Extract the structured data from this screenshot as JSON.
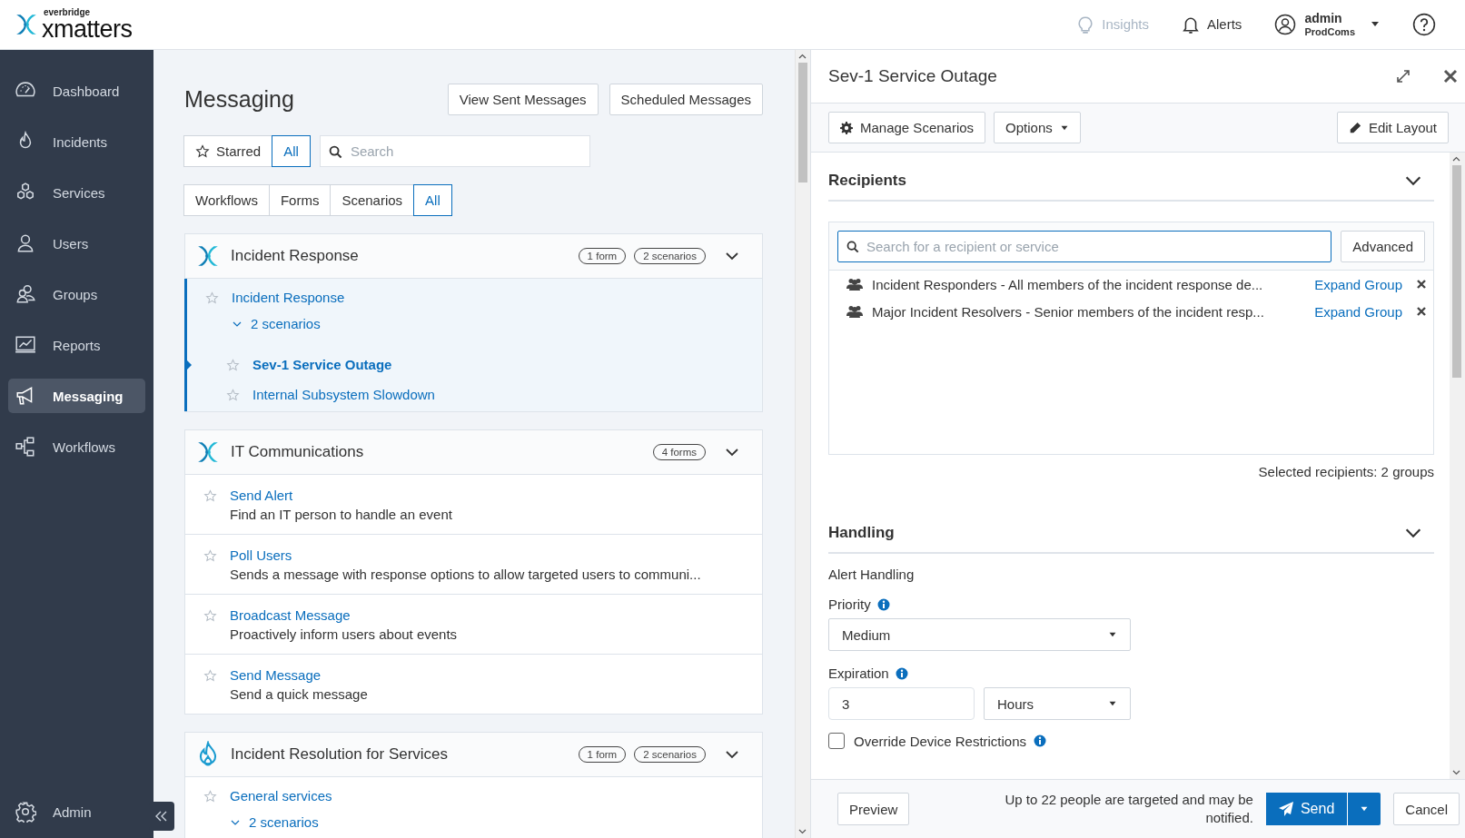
{
  "header": {
    "logo_caption": "everbridge",
    "logo": "xmatters",
    "nav": [
      {
        "label": "Insights",
        "disabled": true
      },
      {
        "label": "Alerts",
        "disabled": false
      }
    ],
    "user": {
      "name": "admin",
      "org": "ProdComs"
    }
  },
  "sidebar": {
    "items": [
      {
        "label": "Dashboard",
        "selected": false
      },
      {
        "label": "Incidents",
        "selected": false
      },
      {
        "label": "Services",
        "selected": false
      },
      {
        "label": "Users",
        "selected": false
      },
      {
        "label": "Groups",
        "selected": false
      },
      {
        "label": "Reports",
        "selected": false
      },
      {
        "label": "Messaging",
        "selected": true
      },
      {
        "label": "Workflows",
        "selected": false
      }
    ],
    "footer_item": {
      "label": "Admin"
    }
  },
  "messaging": {
    "title": "Messaging",
    "buttons": [
      "View Sent Messages",
      "Scheduled Messages"
    ],
    "star_filter": [
      {
        "label": "Starred",
        "selected": false
      },
      {
        "label": "All",
        "selected": true
      }
    ],
    "search": {
      "placeholder": "Search"
    },
    "type_filter": [
      {
        "label": "Workflows",
        "selected": false
      },
      {
        "label": "Forms",
        "selected": false
      },
      {
        "label": "Scenarios",
        "selected": false
      },
      {
        "label": "All",
        "selected": true
      }
    ],
    "groups": [
      {
        "title": "Incident Response",
        "kind": "workflow",
        "badges": [
          "1 form",
          "2 scenarios"
        ],
        "expanded": true,
        "items": [
          {
            "title": "Incident Response",
            "scenarios_toggle": {
              "label": "2 scenarios",
              "expanded": true
            },
            "scenarios": [
              {
                "title": "Sev-1 Service Outage",
                "selected": true
              },
              {
                "title": "Internal Subsystem Slowdown",
                "selected": false
              }
            ]
          }
        ]
      },
      {
        "title": "IT Communications",
        "kind": "workflow",
        "badges": [
          "4 forms"
        ],
        "expanded": true,
        "items": [
          {
            "title": "Send Alert",
            "description": "Find an IT person to handle an event"
          },
          {
            "title": "Poll Users",
            "description": "Sends a message with response options to allow targeted users to communi..."
          },
          {
            "title": "Broadcast Message",
            "description": "Proactively inform users about events"
          },
          {
            "title": "Send Message",
            "description": "Send a quick message"
          }
        ]
      },
      {
        "title": "Incident Resolution for Services",
        "kind": "service",
        "badges": [
          "1 form",
          "2 scenarios"
        ],
        "expanded": true,
        "items": [
          {
            "title": "General services",
            "scenarios_toggle": {
              "label": "2 scenarios",
              "expanded": true
            }
          }
        ]
      }
    ]
  },
  "panel": {
    "title": "Sev-1 Service Outage",
    "toolbar": [
      {
        "label": "Manage Scenarios",
        "kind": "gear"
      },
      {
        "label": "Options",
        "kind": "dropdown"
      },
      {
        "label": "Edit Layout",
        "kind": "pencil"
      }
    ],
    "recipients": {
      "heading": "Recipients",
      "expanded": true,
      "search": {
        "placeholder": "Search for a recipient or service"
      },
      "advanced": "Advanced",
      "list": [
        {
          "name": "Incident Responders - All members of the incident response de...",
          "action": "Expand Group"
        },
        {
          "name": "Major Incident Resolvers - Senior members of the incident resp...",
          "action": "Expand Group"
        }
      ],
      "summary": "Selected recipients: 2 groups"
    },
    "handling": {
      "heading": "Handling",
      "expanded": true,
      "subtitle": "Alert Handling",
      "priority": {
        "label": "Priority",
        "value": "Medium"
      },
      "expiration": {
        "label": "Expiration",
        "value": "3",
        "unit": "Hours"
      },
      "override": {
        "label": "Override Device Restrictions",
        "checked": false
      }
    },
    "footer": {
      "preview": "Preview",
      "note": "Up to 22 people are targeted and may be notified.",
      "send": "Send",
      "cancel": "Cancel"
    }
  }
}
